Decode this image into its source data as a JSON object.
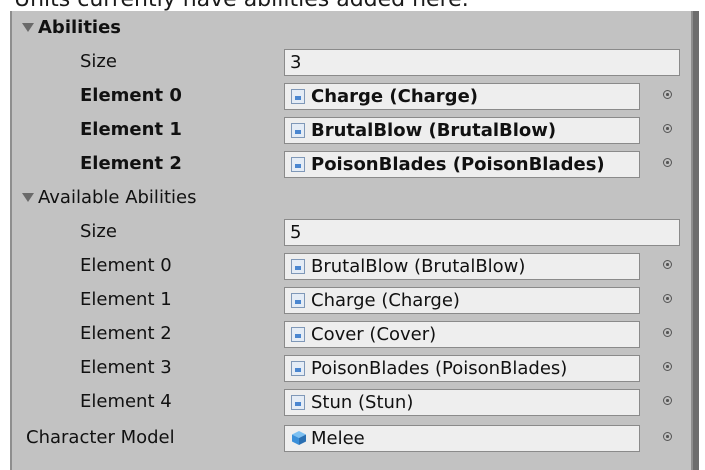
{
  "caption": "Units currently have abilities added here.",
  "abilities": {
    "header": "Abilities",
    "size_label": "Size",
    "size_value": "3",
    "elements": [
      {
        "label": "Element 0",
        "value": "Charge (Charge)"
      },
      {
        "label": "Element 1",
        "value": "BrutalBlow (BrutalBlow)"
      },
      {
        "label": "Element 2",
        "value": "PoisonBlades (PoisonBlades)"
      }
    ]
  },
  "available_abilities": {
    "header": "Available Abilities",
    "size_label": "Size",
    "size_value": "5",
    "elements": [
      {
        "label": "Element 0",
        "value": "BrutalBlow (BrutalBlow)"
      },
      {
        "label": "Element 1",
        "value": "Charge (Charge)"
      },
      {
        "label": "Element 2",
        "value": "Cover (Cover)"
      },
      {
        "label": "Element 3",
        "value": "PoisonBlades (PoisonBlades)"
      },
      {
        "label": "Element 4",
        "value": "Stun (Stun)"
      }
    ]
  },
  "character_model": {
    "label": "Character Model",
    "value": "Melee"
  },
  "icons": {
    "foldout": "triangle-down-icon",
    "script_asset": "script-asset-icon",
    "prefab": "prefab-cube-icon",
    "object_picker": "object-picker-icon"
  },
  "colors": {
    "panel_bg": "#c2c2c2",
    "field_bg": "#eeeeee",
    "prefab_blue": "#3a8fd9"
  }
}
